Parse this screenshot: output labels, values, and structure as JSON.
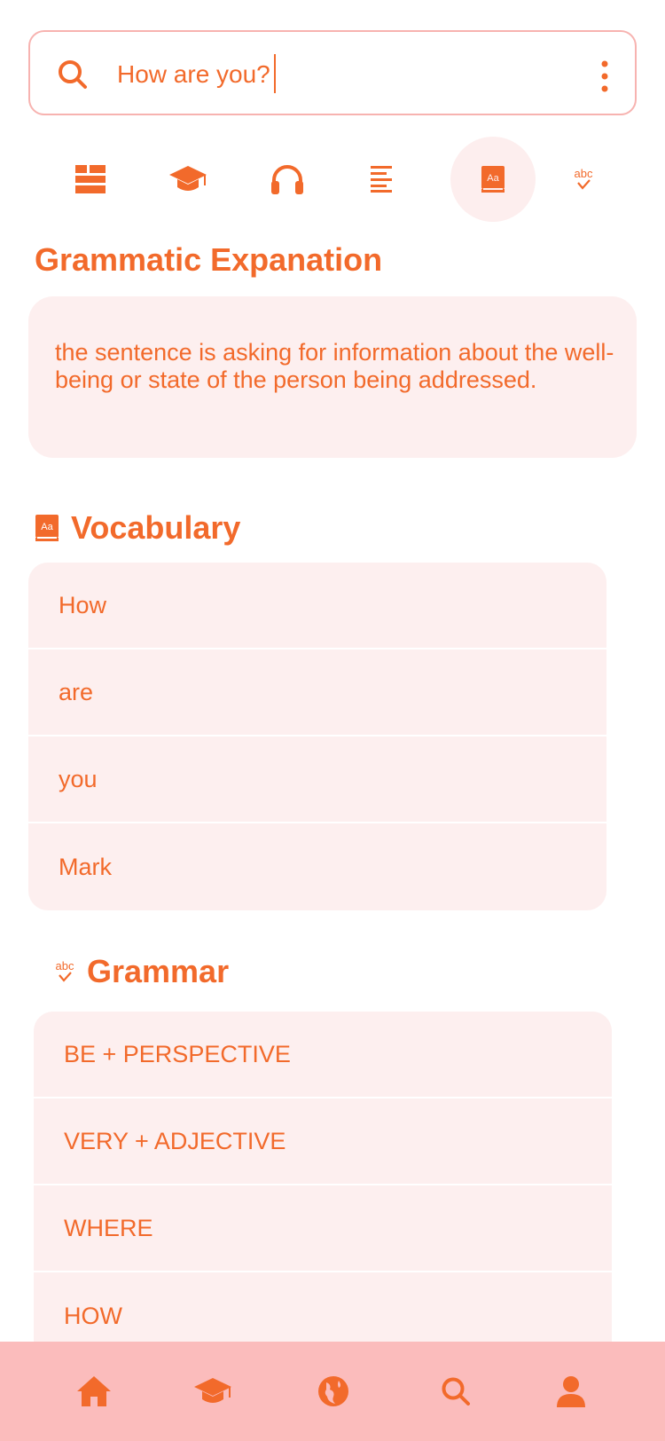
{
  "search": {
    "value": "How are you?",
    "search_icon": "search-icon",
    "menu_icon": "more-vertical-icon"
  },
  "tabs": [
    {
      "name": "dashboard",
      "icon": "grid-icon"
    },
    {
      "name": "learn",
      "icon": "graduation-cap-icon"
    },
    {
      "name": "listen",
      "icon": "headphones-icon"
    },
    {
      "name": "text",
      "icon": "align-left-icon"
    },
    {
      "name": "dictionary",
      "icon": "dictionary-icon",
      "active": true
    },
    {
      "name": "spellcheck",
      "icon": "spellcheck-icon"
    }
  ],
  "explanation": {
    "title": "Grammatic Expanation",
    "text": "the sentence is asking for information about the well-being or state of the person being addressed."
  },
  "vocabulary": {
    "title": "Vocabulary",
    "items": [
      "How",
      "are",
      "you",
      "Mark"
    ]
  },
  "grammar": {
    "title": "Grammar",
    "items": [
      "BE + PERSPECTIVE",
      "VERY + ADJECTIVE",
      "WHERE",
      "HOW"
    ]
  },
  "bottom_nav": [
    {
      "name": "home",
      "icon": "home-icon"
    },
    {
      "name": "learn",
      "icon": "graduation-cap-icon"
    },
    {
      "name": "explore",
      "icon": "globe-icon"
    },
    {
      "name": "search",
      "icon": "search-icon"
    },
    {
      "name": "profile",
      "icon": "user-icon"
    }
  ],
  "colors": {
    "accent": "#f26a2b",
    "card_bg": "#fdefef",
    "border": "#f7b3b0",
    "nav_bg": "#fbbcbc"
  }
}
